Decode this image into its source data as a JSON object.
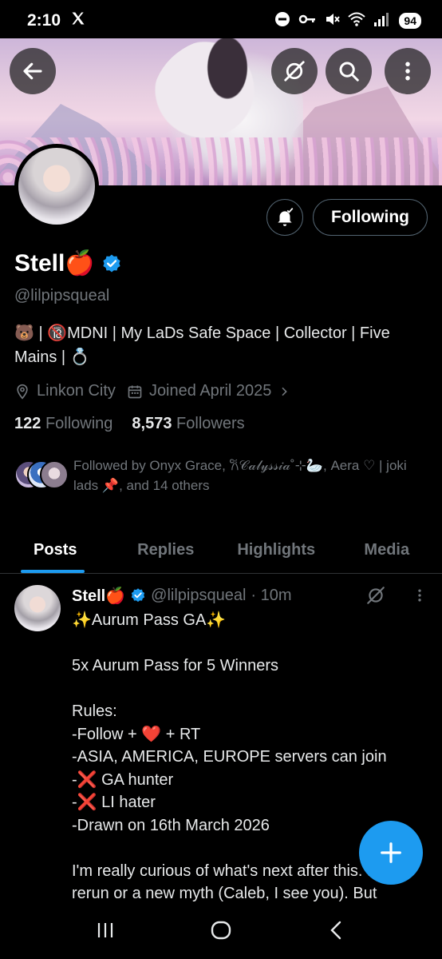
{
  "status": {
    "time": "2:10",
    "battery": "94"
  },
  "profile": {
    "name": "Stell🍎",
    "handle": "@lilpipsqueal",
    "bio": "🐻 | 🔞MDNI | My LaDs Safe Space | Collector | Five Mains | 💍",
    "location": "Linkon City",
    "joined": "Joined April 2025",
    "following_count": "122",
    "following_label": "Following",
    "followers_count": "8,573",
    "followers_label": "Followers",
    "followed_by": "Followed by Onyx Grace, 𐙚𝒞𝒶𝓁𝓎𝓈𝓈𝒾𝒶˚⊹🦢, Aera ♡ | joki lads 📌, and 14 others"
  },
  "actions": {
    "following_button": "Following"
  },
  "tabs": [
    {
      "label": "Posts",
      "active": true
    },
    {
      "label": "Replies",
      "active": false
    },
    {
      "label": "Highlights",
      "active": false
    },
    {
      "label": "Media",
      "active": false
    }
  ],
  "post": {
    "name": "Stell🍎",
    "handle": "@lilpipsqueal",
    "time": "· 10m",
    "text": "✨Aurum Pass GA✨\n\n5x Aurum Pass for 5 Winners\n\nRules:\n-Follow + ❤️ + RT\n-ASIA, AMERICA, EUROPE servers can join\n-❌ GA hunter\n-❌ LI hater\n-Drawn on 16th March 2026\n\nI'm really curious of what's next after this. Is it a rerun or a new myth (Caleb, I see you). But"
  },
  "colors": {
    "accent": "#1d9bf0",
    "muted": "#71767b",
    "background": "#000000"
  }
}
